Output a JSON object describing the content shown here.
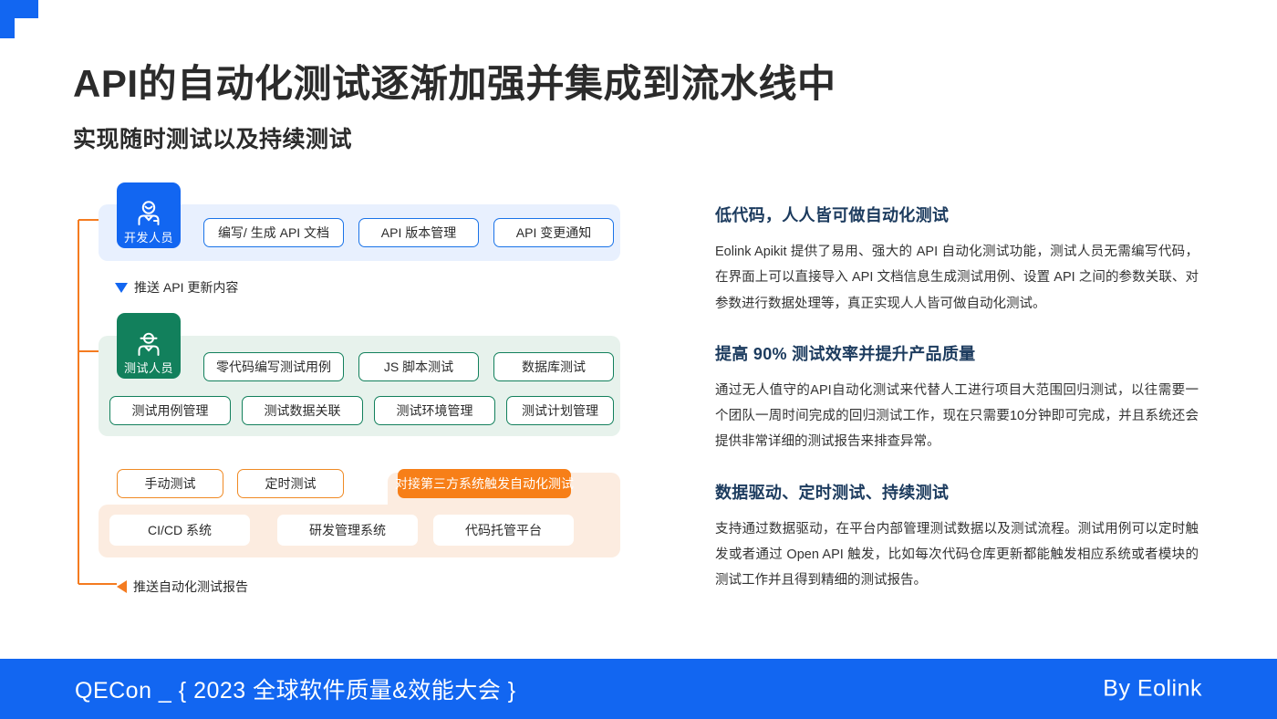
{
  "header": {
    "title": "API的自动化测试逐渐加强并集成到流水线中",
    "subtitle": "实现随时测试以及持续测试"
  },
  "diagram": {
    "developer_role": {
      "label": "开发人员",
      "icon": "person-smile-icon",
      "color": "#1266f1"
    },
    "developer_chips": [
      "编写/ 生成 API 文档",
      "API 版本管理",
      "API 变更通知"
    ],
    "flow_down_label": "推送 API 更新内容",
    "tester_role": {
      "label": "测试人员",
      "icon": "person-cap-icon",
      "color": "#12805c"
    },
    "tester_chips_row1": [
      "零代码编写测试用例",
      "JS 脚本测试",
      "数据库测试"
    ],
    "tester_chips_row2": [
      "测试用例管理",
      "测试数据关联",
      "测试环境管理",
      "测试计划管理"
    ],
    "trigger_chips": [
      "手动测试",
      "定时测试"
    ],
    "trigger_highlight": "对接第三方系统触发自动化测试",
    "platform_chips": [
      "CI/CD 系统",
      "研发管理系统",
      "代码托管平台"
    ],
    "flow_back_label": "推送自动化测试报告",
    "colors": {
      "blue_panel": "#e8f0fe",
      "green_panel": "#e7f2ec",
      "orange_panel": "#fcece0",
      "orange_accent": "#f77f18"
    }
  },
  "content": {
    "sections": [
      {
        "heading": "低代码，人人皆可做自动化测试",
        "body": "Eolink Apikit 提供了易用、强大的 API 自动化测试功能，测试人员无需编写代码，在界面上可以直接导入 API 文档信息生成测试用例、设置 API 之间的参数关联、对参数进行数据处理等，真正实现人人皆可做自动化测试。"
      },
      {
        "heading": "提高 90% 测试效率并提升产品质量",
        "body": "通过无人值守的API自动化测试来代替人工进行项目大范围回归测试，以往需要一个团队一周时间完成的回归测试工作，现在只需要10分钟即可完成，并且系统还会提供非常详细的测试报告来排查异常。"
      },
      {
        "heading": "数据驱动、定时测试、持续测试",
        "body": "支持通过数据驱动，在平台内部管理测试数据以及测试流程。测试用例可以定时触发或者通过 Open API 触发，比如每次代码仓库更新都能触发相应系统或者模块的测试工作并且得到精细的测试报告。"
      }
    ]
  },
  "footer": {
    "left": "QECon _ { 2023 全球软件质量&效能大会 }",
    "right": "By Eolink",
    "color": "#1266f1"
  }
}
